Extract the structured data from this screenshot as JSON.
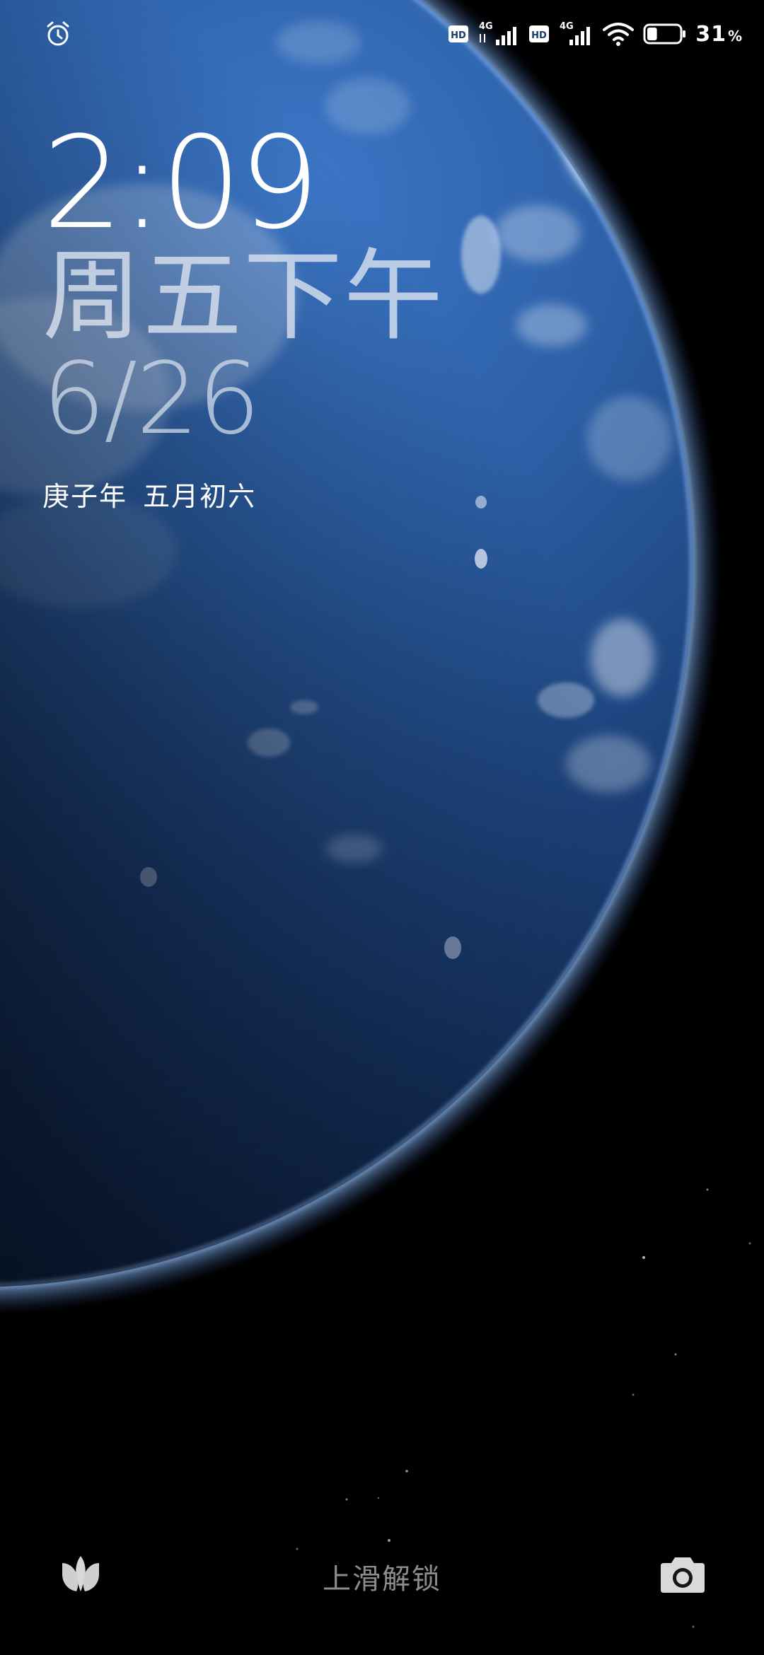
{
  "status_bar": {
    "alarm_icon": "alarm-clock-icon",
    "sim1_hd": "HD",
    "sim1_net": "4G",
    "sim2_hd": "HD",
    "sim2_net": "4G",
    "wifi_icon": "wifi-icon",
    "battery_level": 0.31,
    "battery_value": "31",
    "battery_unit": "%"
  },
  "lockscreen": {
    "time": "2:09",
    "weekday": "周五下午",
    "date": "6/26",
    "lunar": "庚子年 五月初六",
    "unlock_hint": "上滑解锁",
    "left_shortcut_icon": "tulip-icon",
    "right_shortcut_icon": "camera-icon"
  },
  "colors": {
    "ocean": "#2b5fa8",
    "space": "#000000",
    "atmosphere": "#6fa8ff"
  }
}
